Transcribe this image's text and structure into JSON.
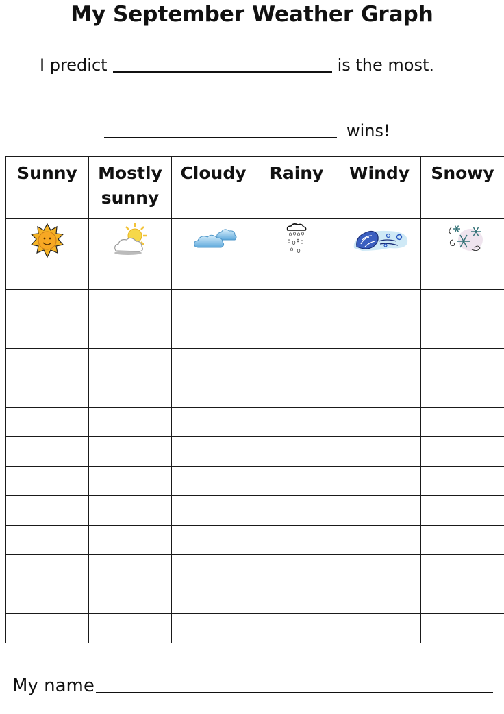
{
  "title": "My September Weather Graph",
  "prediction": {
    "prefix": "I predict",
    "suffix": "is the most.",
    "answer": ""
  },
  "winner": {
    "answer": "",
    "suffix": "wins!"
  },
  "table": {
    "columns": [
      {
        "label": "Sunny",
        "icon": "sun-icon"
      },
      {
        "label": "Mostly sunny",
        "icon": "sun-behind-cloud-icon"
      },
      {
        "label": "Cloudy",
        "icon": "clouds-icon"
      },
      {
        "label": "Rainy",
        "icon": "rain-cloud-icon"
      },
      {
        "label": "Windy",
        "icon": "wind-icon"
      },
      {
        "label": "Snowy",
        "icon": "snowflake-icon"
      }
    ],
    "empty_rows": 13
  },
  "footer": {
    "name_label": "My name",
    "name_value": ""
  },
  "colors": {
    "sun": "#F5B325",
    "cloud_blue": "#7EC0EA",
    "wind_blue": "#1F3F9A",
    "snow_teal": "#2F6F74",
    "line": "#1a1a1a"
  }
}
